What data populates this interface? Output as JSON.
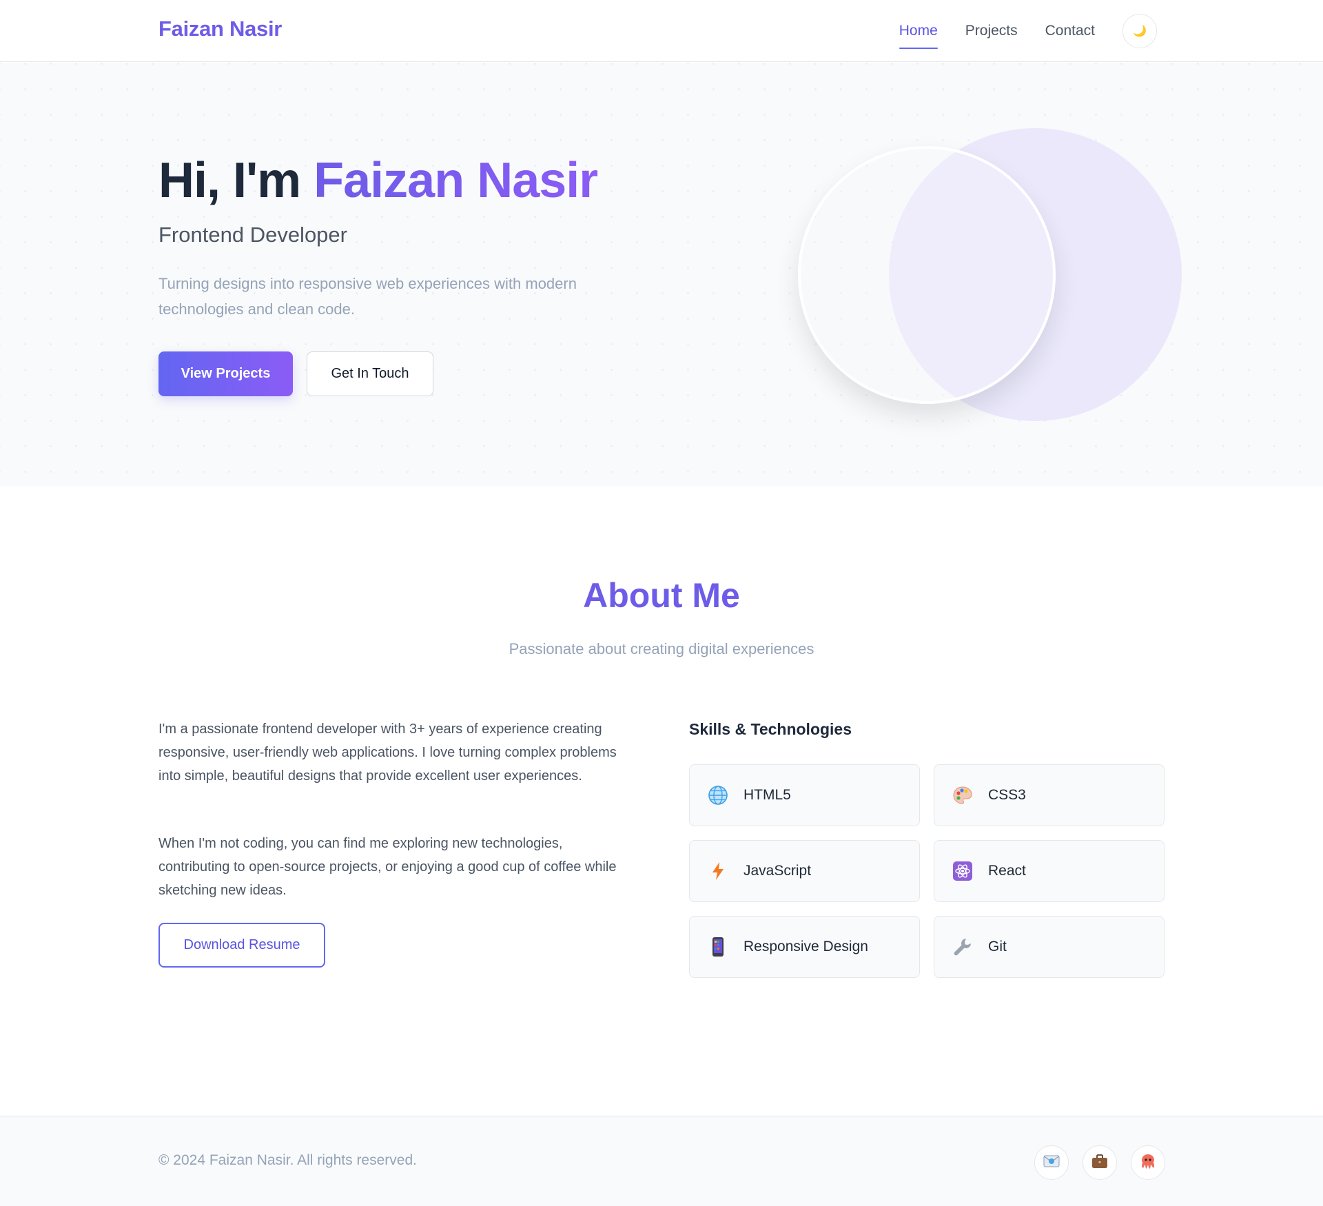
{
  "nav": {
    "logo": "Faizan Nasir",
    "links": [
      {
        "label": "Home",
        "active": true
      },
      {
        "label": "Projects",
        "active": false
      },
      {
        "label": "Contact",
        "active": false
      }
    ],
    "theme_toggle_icon": "moon-icon",
    "theme_toggle_glyph": "🌙"
  },
  "hero": {
    "greeting": "Hi, I'm ",
    "name": "Faizan Nasir",
    "subtitle": "Frontend Developer",
    "description": "Turning designs into responsive web experiences with modern technologies and clean code.",
    "primary_button": "View Projects",
    "secondary_button": "Get In Touch"
  },
  "about": {
    "title": "About Me",
    "subtitle": "Passionate about creating digital experiences",
    "paragraph_1": "I'm a passionate frontend developer with 3+ years of experience creating responsive, user-friendly web applications. I love turning complex problems into simple, beautiful designs that provide excellent user experiences.",
    "paragraph_2": "When I'm not coding, you can find me exploring new technologies, contributing to open-source projects, or enjoying a good cup of coffee while sketching new ideas.",
    "resume_button": "Download Resume",
    "skills_title": "Skills & Technologies",
    "skills": [
      {
        "label": "HTML5",
        "icon": "globe-icon"
      },
      {
        "label": "CSS3",
        "icon": "palette-icon"
      },
      {
        "label": "JavaScript",
        "icon": "lightning-icon"
      },
      {
        "label": "React",
        "icon": "atom-icon"
      },
      {
        "label": "Responsive Design",
        "icon": "mobile-phone-icon"
      },
      {
        "label": "Git",
        "icon": "wrench-icon"
      }
    ]
  },
  "footer": {
    "copyright": "© 2024 Faizan Nasir. All rights reserved.",
    "social": [
      {
        "name": "email-icon"
      },
      {
        "name": "briefcase-icon"
      },
      {
        "name": "github-octocat-icon"
      }
    ]
  },
  "colors": {
    "accent": "#6d5ce8",
    "accent_gradient_start": "#6366f1",
    "accent_gradient_end": "#8b5cf6",
    "text_dark": "#1e293b",
    "text_muted": "#94a3b8"
  }
}
